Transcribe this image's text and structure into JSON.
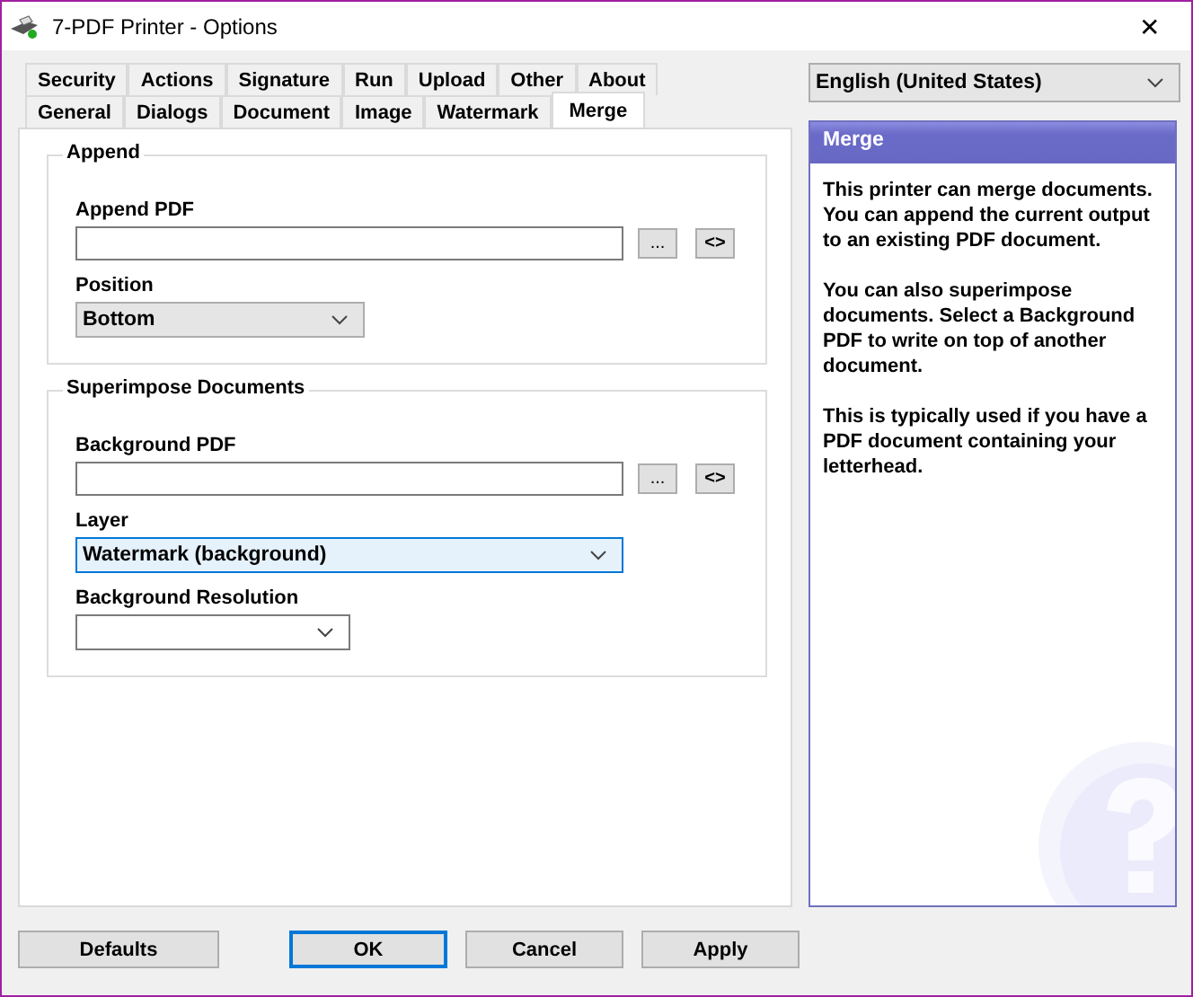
{
  "window": {
    "title": "7-PDF Printer - Options",
    "close": "✕"
  },
  "tab_rows": [
    [
      {
        "label": "Security",
        "selected": false
      },
      {
        "label": "Actions",
        "selected": false
      },
      {
        "label": "Signature",
        "selected": false
      },
      {
        "label": "Run",
        "selected": false
      },
      {
        "label": "Upload",
        "selected": false
      },
      {
        "label": "Other",
        "selected": false
      },
      {
        "label": "About",
        "selected": false
      }
    ],
    [
      {
        "label": "General",
        "selected": false
      },
      {
        "label": "Dialogs",
        "selected": false
      },
      {
        "label": "Document",
        "selected": false
      },
      {
        "label": "Image",
        "selected": false
      },
      {
        "label": "Watermark",
        "selected": false
      },
      {
        "label": "Merge",
        "selected": true
      }
    ]
  ],
  "groups": [
    {
      "title": "Append",
      "fields": [
        {
          "kind": "file",
          "label": "Append PDF",
          "browse": "...",
          "swap": "<>"
        },
        {
          "kind": "select",
          "label": "Position",
          "value": "Bottom",
          "focused": false
        }
      ]
    },
    {
      "title": "Superimpose Documents",
      "fields": [
        {
          "kind": "file",
          "label": "Background PDF",
          "browse": "...",
          "swap": "<>"
        },
        {
          "kind": "select",
          "label": "Layer",
          "value": "Watermark (background)",
          "focused": true
        },
        {
          "kind": "select",
          "label": "Background Resolution",
          "focused": false
        }
      ]
    }
  ],
  "language": {
    "value": "English (United States)"
  },
  "help": {
    "title": "Merge",
    "paragraphs": [
      "This printer can merge documents. You can append the current output to an existing PDF document.",
      "You can also superimpose documents. Select a Background PDF to write on top of another document.",
      "This is typically used if you have a PDF document containing your letterhead."
    ]
  },
  "buttons": [
    {
      "label": "Defaults",
      "default": false
    },
    {
      "label": "OK",
      "default": true
    },
    {
      "label": "Cancel",
      "default": false
    },
    {
      "label": "Apply",
      "default": false
    }
  ]
}
